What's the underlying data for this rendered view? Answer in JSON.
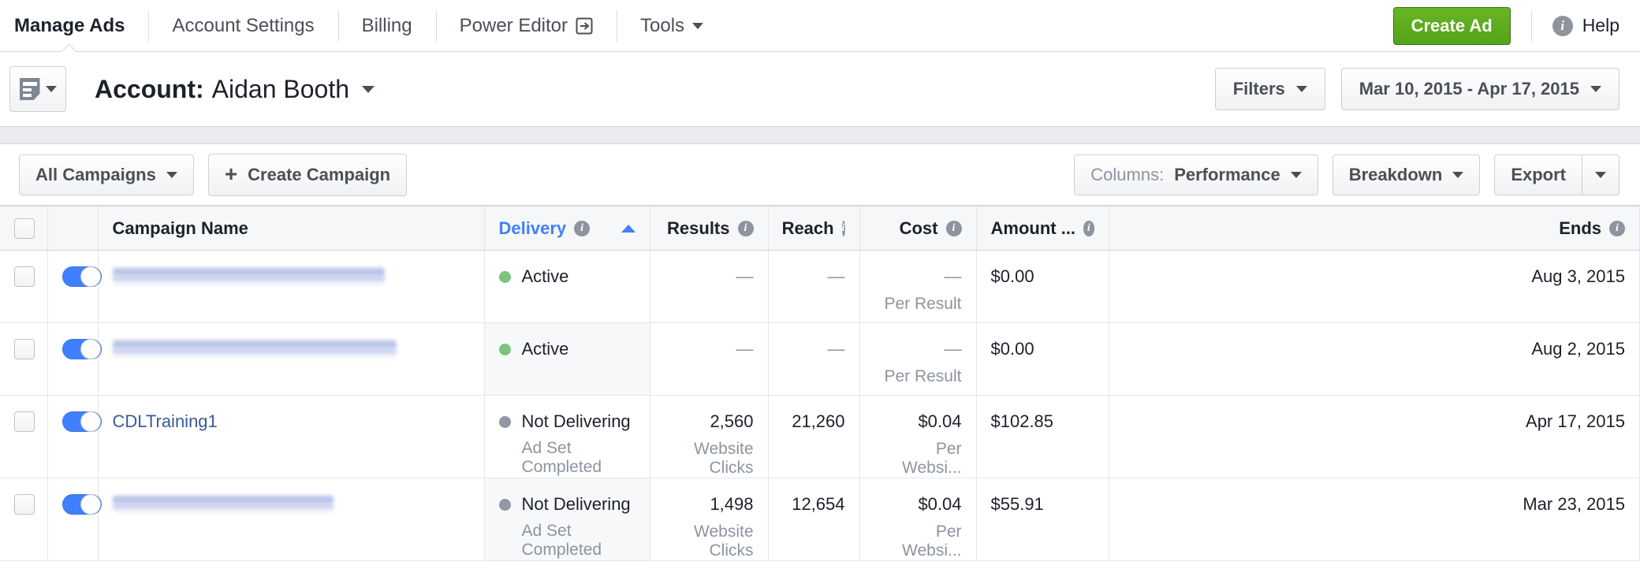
{
  "topnav": {
    "items": [
      {
        "label": "Manage Ads",
        "active": true,
        "icon": null,
        "caret": false
      },
      {
        "label": "Account Settings",
        "active": false,
        "icon": null,
        "caret": false
      },
      {
        "label": "Billing",
        "active": false,
        "icon": null,
        "caret": false
      },
      {
        "label": "Power Editor",
        "active": false,
        "icon": "external-link-icon",
        "caret": false
      },
      {
        "label": "Tools",
        "active": false,
        "icon": null,
        "caret": true
      }
    ],
    "create_ad_label": "Create Ad",
    "help_label": "Help",
    "help_icon": "info-icon"
  },
  "account_bar": {
    "icon_button_icon": "document-list-icon",
    "label": "Account",
    "separator": ":",
    "value": "Aidan Booth",
    "filters_label": "Filters",
    "date_range": "Mar 10, 2015 - Apr 17, 2015"
  },
  "toolbar": {
    "all_campaigns_label": "All Campaigns",
    "create_campaign_label": "Create Campaign",
    "create_campaign_icon": "plus-icon",
    "columns_prefix": "Columns:",
    "columns_value": "Performance",
    "breakdown_label": "Breakdown",
    "export_label": "Export"
  },
  "table": {
    "headers": {
      "campaign_name": "Campaign Name",
      "delivery": "Delivery",
      "results": "Results",
      "reach": "Reach",
      "cost": "Cost",
      "amount": "Amount ...",
      "ends": "Ends"
    },
    "sort_column": "Delivery",
    "sort_direction": "ascending",
    "rows": [
      {
        "checked": false,
        "toggle_on": true,
        "name": null,
        "name_redacted": true,
        "delivery_status": "Active",
        "delivery_dot": "green",
        "delivery_sub": null,
        "results": "—",
        "results_sub": null,
        "reach": "—",
        "cost": "—",
        "cost_sub": "Per Result",
        "amount": "$0.00",
        "ends": "Aug 3, 2015"
      },
      {
        "checked": false,
        "toggle_on": true,
        "name": null,
        "name_redacted": true,
        "delivery_status": "Active",
        "delivery_dot": "green",
        "delivery_sub": null,
        "results": "—",
        "results_sub": null,
        "reach": "—",
        "cost": "—",
        "cost_sub": "Per Result",
        "amount": "$0.00",
        "ends": "Aug 2, 2015"
      },
      {
        "checked": false,
        "toggle_on": true,
        "name": "CDLTraining1",
        "name_redacted": false,
        "delivery_status": "Not Delivering",
        "delivery_dot": "gray",
        "delivery_sub": "Ad Set Completed",
        "results": "2,560",
        "results_sub": "Website Clicks",
        "reach": "21,260",
        "cost": "$0.04",
        "cost_sub": "Per Websi...",
        "amount": "$102.85",
        "ends": "Apr 17, 2015"
      },
      {
        "checked": false,
        "toggle_on": true,
        "name": null,
        "name_redacted": true,
        "delivery_status": "Not Delivering",
        "delivery_dot": "gray",
        "delivery_sub": "Ad Set Completed",
        "results": "1,498",
        "results_sub": "Website Clicks",
        "reach": "12,654",
        "cost": "$0.04",
        "cost_sub": "Per Websi...",
        "amount": "$55.91",
        "ends": "Mar 23, 2015"
      }
    ]
  },
  "colors": {
    "accent_blue": "#4080ff",
    "link_blue": "#3b5998",
    "create_ad_green": "#55a317",
    "status_active_green": "#7dc47d",
    "status_not_delivering_gray": "#9197a3",
    "muted_text": "#8d949e"
  }
}
